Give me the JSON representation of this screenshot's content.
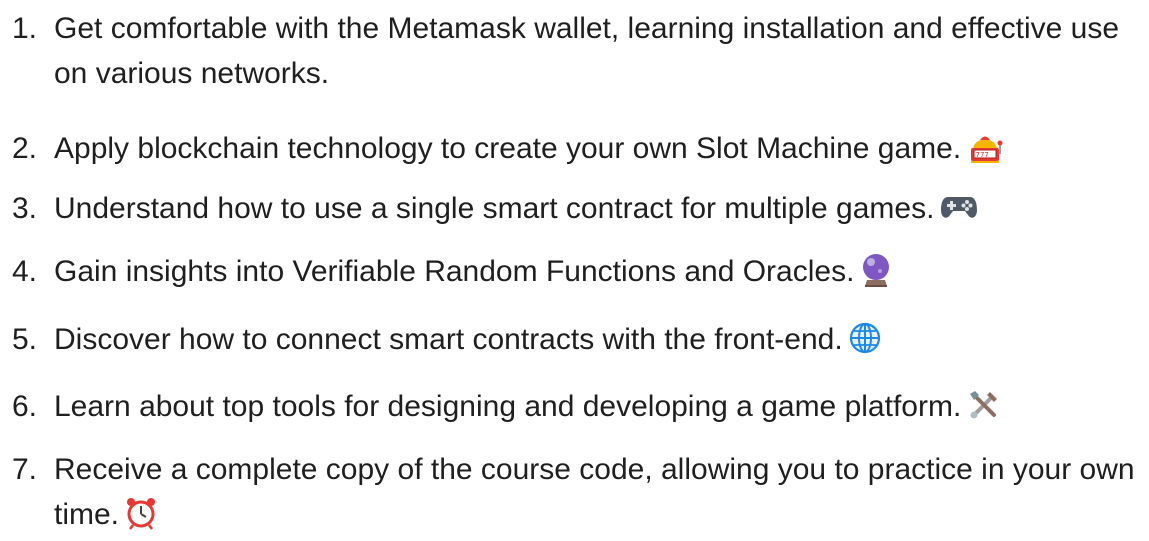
{
  "items": [
    {
      "number": "1.",
      "text": "Get comfortable with the Metamask wallet, learning installation and effective use on various networks.",
      "emoji": ""
    },
    {
      "number": "2.",
      "text": "Apply blockchain technology to create your own Slot Machine game.",
      "emoji": "slot-machine-icon"
    },
    {
      "number": "3.",
      "text": "Understand how to use a single smart contract for multiple games.",
      "emoji": "game-controller-icon"
    },
    {
      "number": "4.",
      "text": "Gain insights into Verifiable Random Functions and Oracles.",
      "emoji": "crystal-ball-icon"
    },
    {
      "number": "5.",
      "text": "Discover how to connect smart contracts with the front-end.",
      "emoji": "globe-icon"
    },
    {
      "number": "6.",
      "text": "Learn about top tools for designing and developing a game platform.",
      "emoji": "hammer-wrench-icon"
    },
    {
      "number": "7.",
      "text": "Receive a complete copy of the course code, allowing you to practice in your own time.",
      "emoji": "alarm-clock-icon"
    }
  ]
}
